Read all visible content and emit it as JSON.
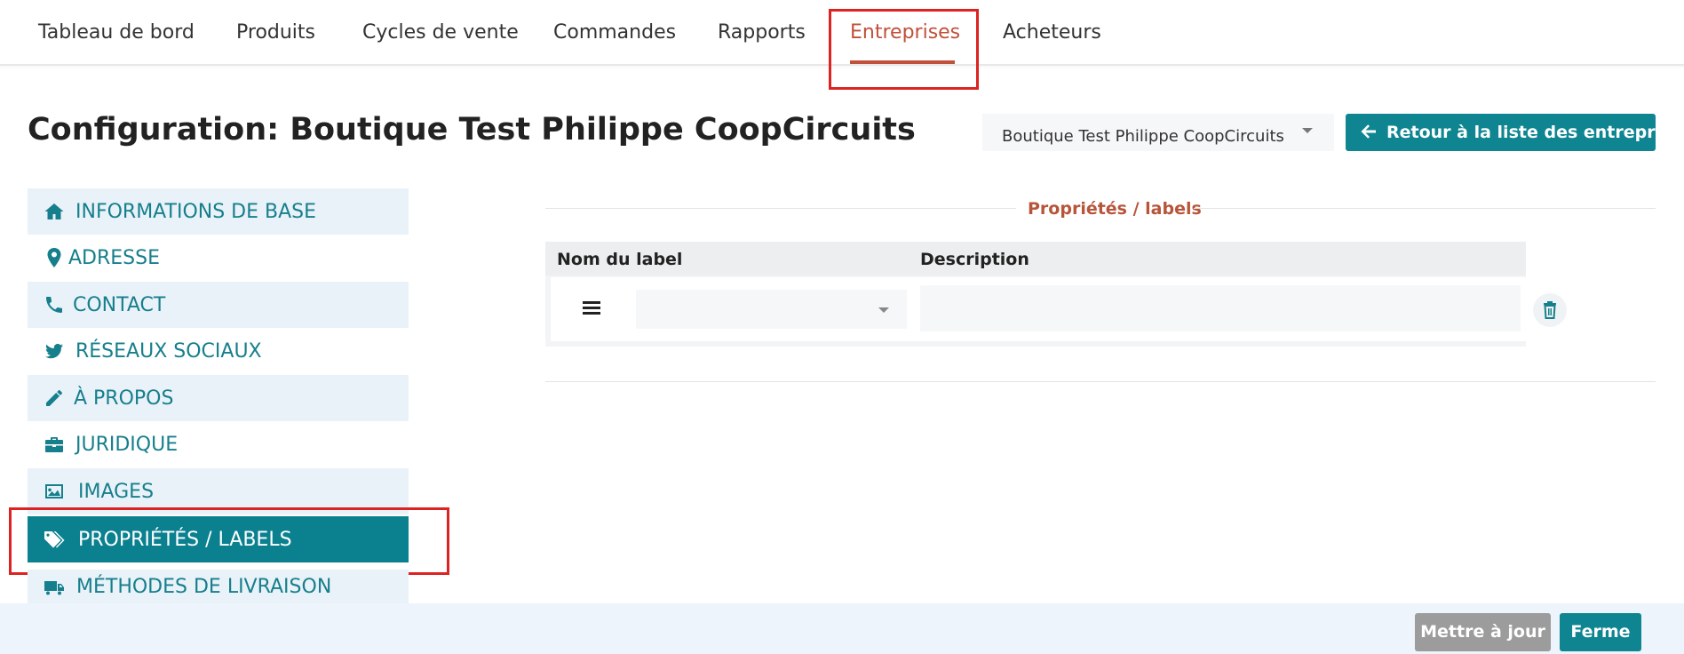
{
  "nav": {
    "tabs": [
      {
        "label": "Tableau de bord"
      },
      {
        "label": "Produits"
      },
      {
        "label": "Cycles de vente"
      },
      {
        "label": "Commandes"
      },
      {
        "label": "Rapports"
      },
      {
        "label": "Entreprises",
        "active": true
      },
      {
        "label": "Acheteurs"
      }
    ]
  },
  "page": {
    "title": "Configuration: Boutique Test Philippe CoopCircuits",
    "company_select": "Boutique Test Philippe CoopCircuits",
    "back_button": "Retour à la liste des entreprises"
  },
  "sidebar": {
    "items": [
      {
        "label": "INFORMATIONS DE BASE",
        "icon": "home-icon"
      },
      {
        "label": "ADRESSE",
        "icon": "map-marker-icon"
      },
      {
        "label": "CONTACT",
        "icon": "phone-icon"
      },
      {
        "label": "RÉSEAUX SOCIAUX",
        "icon": "twitter-icon"
      },
      {
        "label": "À PROPOS",
        "icon": "pencil-icon"
      },
      {
        "label": "JURIDIQUE",
        "icon": "briefcase-icon"
      },
      {
        "label": "IMAGES",
        "icon": "image-icon"
      },
      {
        "label": "PROPRIÉTÉS / LABELS",
        "icon": "tags-icon",
        "active": true
      },
      {
        "label": "MÉTHODES DE LIVRAISON",
        "icon": "truck-icon"
      }
    ]
  },
  "section": {
    "title": "Propriétés / labels",
    "columns": [
      "Nom du label",
      "Description"
    ],
    "rows": [
      {
        "label": "",
        "description": ""
      }
    ]
  },
  "footer": {
    "update_button": "Mettre à jour",
    "close_button": "Ferme"
  },
  "colors": {
    "accent": "#0e8591",
    "active_tab": "#c0503a",
    "highlight_box": "#dd2222",
    "sidebar_shade": "#eaf2f9"
  }
}
